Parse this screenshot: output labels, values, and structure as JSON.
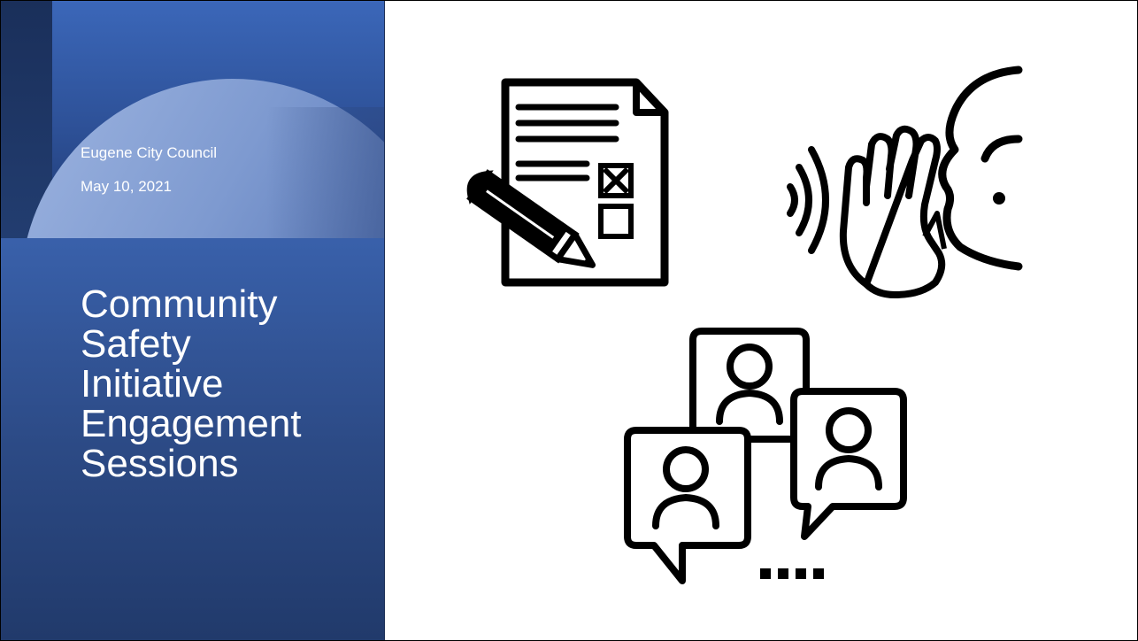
{
  "slide": {
    "subtitle_line1": "Eugene City Council",
    "subtitle_line2": "May 10, 2021",
    "title_lines": [
      "Community",
      "Safety",
      "Initiative",
      "Engagement",
      "Sessions"
    ]
  },
  "icons": {
    "form": "survey-form-pencil-icon",
    "listen": "listening-ear-icon",
    "chat": "group-chat-people-icon"
  },
  "colors": {
    "panel_blue": "#4472c4",
    "panel_dark": "#213a6b",
    "arc_light": "#9db4e0",
    "icon_stroke": "#000000"
  }
}
